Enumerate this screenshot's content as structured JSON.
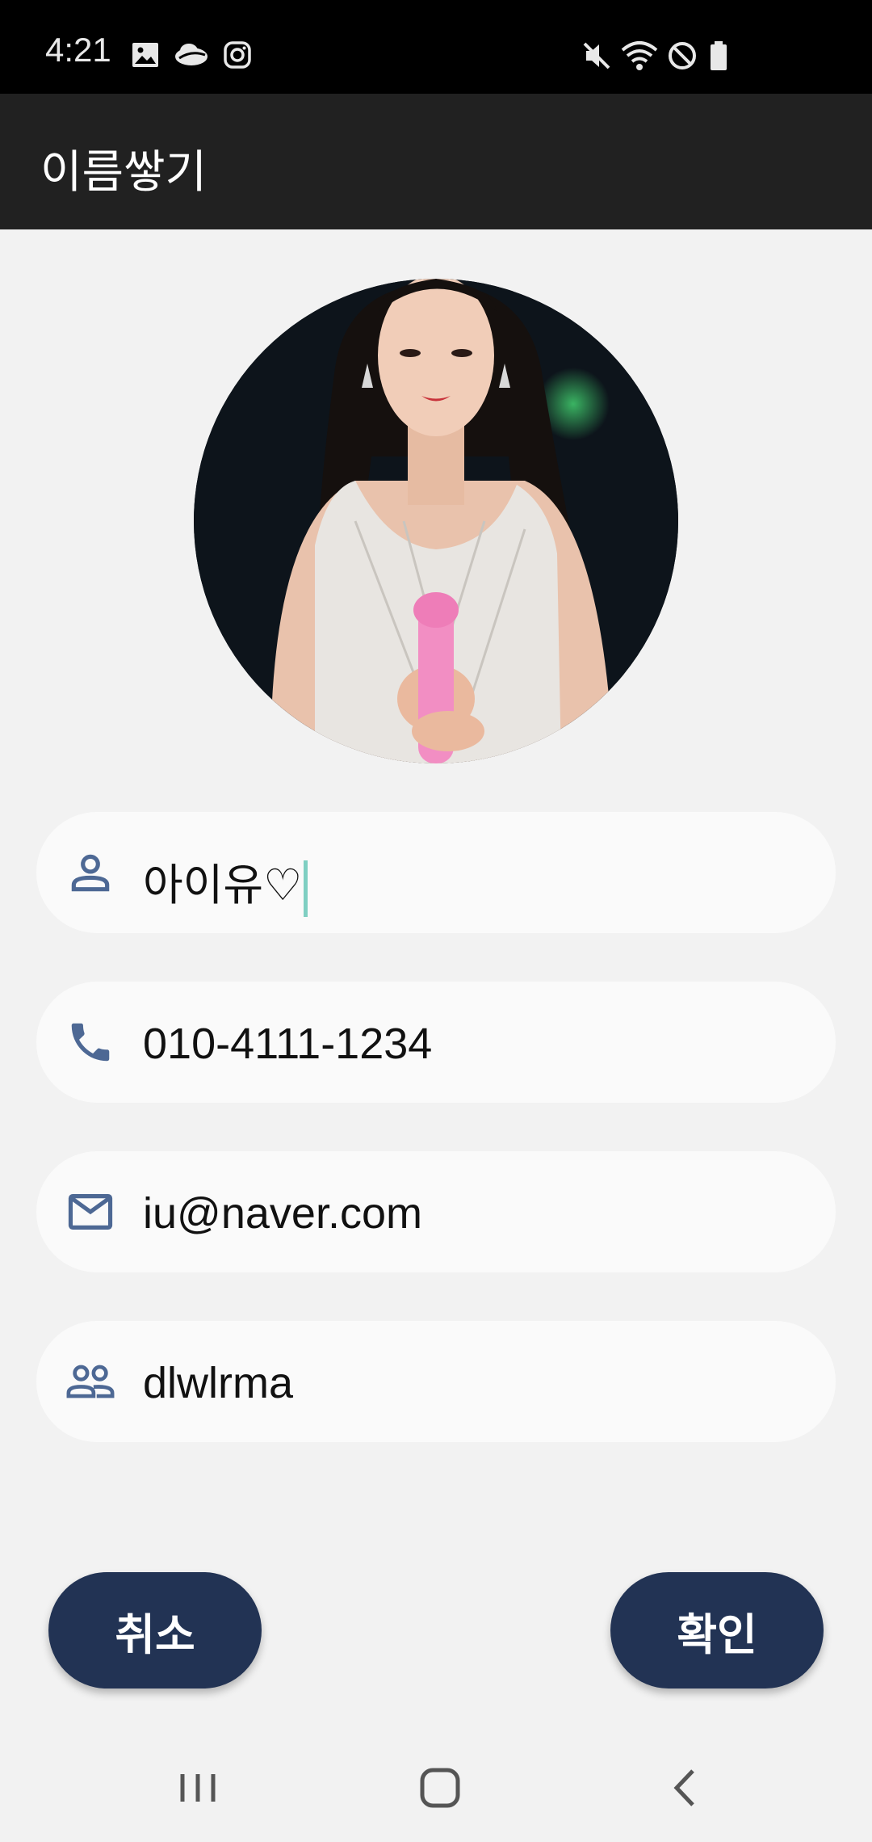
{
  "status_bar": {
    "time": "4:21",
    "left_icons": [
      "gallery-icon",
      "cloud-icon",
      "instagram-icon"
    ],
    "right_icons": [
      "mute-icon",
      "wifi-icon",
      "do-not-disturb-icon",
      "battery-icon"
    ]
  },
  "app_bar": {
    "title": "이름쌓기"
  },
  "profile": {
    "photo": "profile-photo"
  },
  "fields": [
    {
      "icon": "person-icon",
      "value": "아이유♡"
    },
    {
      "icon": "phone-icon",
      "value": "010-4111-1234"
    },
    {
      "icon": "mail-icon",
      "value": "iu@naver.com"
    },
    {
      "icon": "group-icon",
      "value": "dlwlrma"
    }
  ],
  "buttons": {
    "cancel": "취소",
    "confirm": "확인"
  },
  "nav_bar": {
    "buttons": [
      "recents-icon",
      "home-icon",
      "back-icon"
    ]
  },
  "colors": {
    "accent": "#223354",
    "icon": "#4d6894",
    "caret": "#7fcfc2",
    "app_bar": "#212121"
  }
}
